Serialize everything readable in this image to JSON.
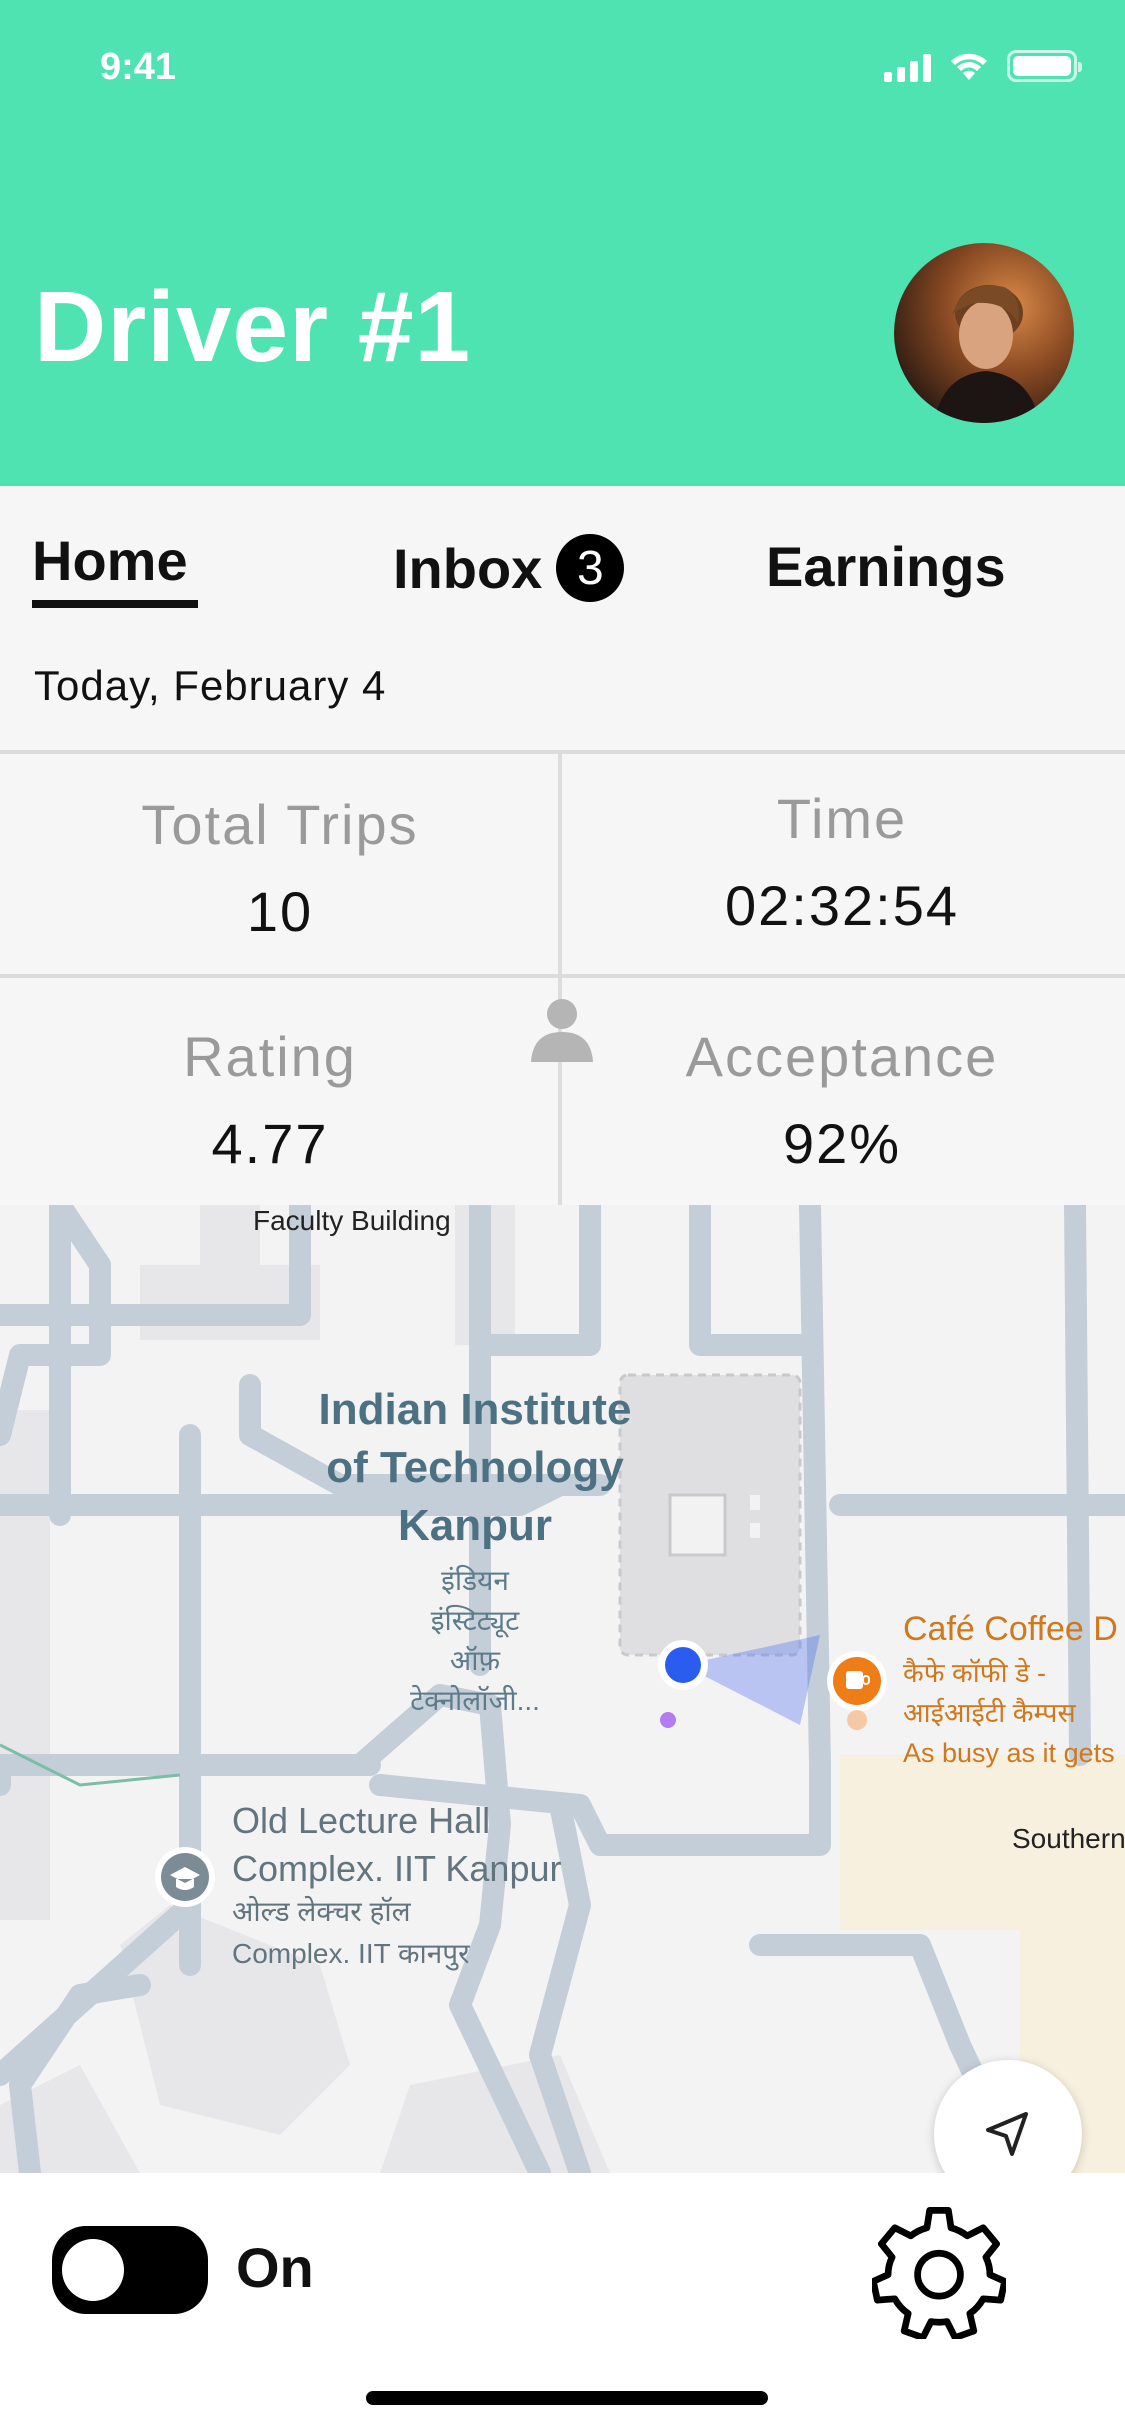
{
  "status_bar": {
    "time": "9:41"
  },
  "header": {
    "title": "Driver #1",
    "background": "#50e3b2"
  },
  "tabs": {
    "home": "Home",
    "inbox": "Inbox",
    "inbox_badge": "3",
    "earnings": "Earnings",
    "active": "Home"
  },
  "date": "Today, February 4",
  "stats": {
    "total_trips": {
      "label": "Total Trips",
      "value": "10"
    },
    "time": {
      "label": "Time",
      "value": "02:32:54"
    },
    "rating": {
      "label": "Rating",
      "value": "4.77"
    },
    "acceptance": {
      "label": "Acceptance",
      "value": "92%"
    }
  },
  "map": {
    "faculty_building": "Faculty Building",
    "campus_name": [
      "Indian Institute",
      "of Technology",
      "Kanpur"
    ],
    "campus_hindi": [
      "इंडियन",
      "इंस्टिट्यूट",
      "ऑफ़",
      "टेक्नोलॉजी..."
    ],
    "lecture_hall": [
      "Old Lecture Hall",
      "Complex. IIT Kanpur"
    ],
    "lecture_hall_hindi": [
      "ओल्ड लेक्चर हॉल",
      "Complex. IIT कानपुर"
    ],
    "cafe_name": "Café Coffee D",
    "cafe_hindi": [
      "कैफे कॉफी डे -",
      "आईआईटी कैम्पस"
    ],
    "cafe_busy": "As busy as it gets",
    "southern": "Southern"
  },
  "bottom_bar": {
    "toggle_label": "On",
    "toggle_on": true
  },
  "icons": {
    "avatar": "avatar-photo",
    "person": "person-icon",
    "recenter": "navigation-arrow-icon",
    "settings": "gear-icon",
    "lecture_pin": "graduation-cap-icon",
    "cafe_pin": "coffee-cup-icon"
  }
}
